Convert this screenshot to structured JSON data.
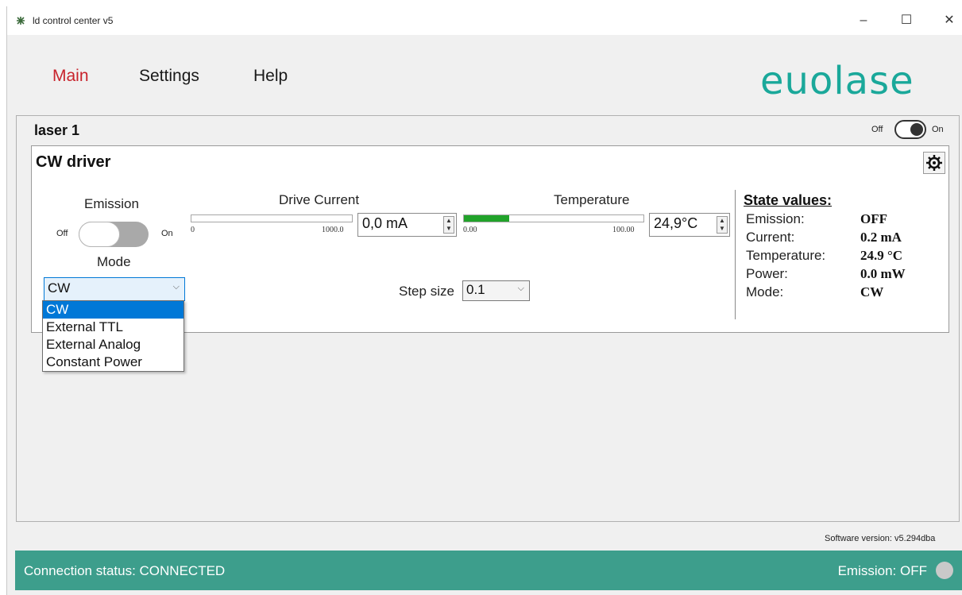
{
  "window": {
    "title": "ld control center v5",
    "minimize": "–",
    "maximize": "☐",
    "close": "✕"
  },
  "menu": {
    "items": [
      {
        "label": "Main",
        "active": true
      },
      {
        "label": "Settings",
        "active": false
      },
      {
        "label": "Help",
        "active": false
      }
    ],
    "logo_text": "euolase"
  },
  "laser": {
    "title": "laser 1",
    "toggle_off": "Off",
    "toggle_on": "On"
  },
  "cw_driver": {
    "title": "CW driver",
    "emission_label": "Emission",
    "emission_off": "Off",
    "emission_on": "On",
    "mode_label": "Mode",
    "mode_value": "CW",
    "drive_current": {
      "label": "Drive Current",
      "min": "0",
      "max": "1000.0",
      "value": "0,0 mA",
      "fill_fraction": 0.0
    },
    "temperature": {
      "label": "Temperature",
      "min": "0.00",
      "max": "100.00",
      "value": "24,9°C",
      "fill_fraction": 0.25
    },
    "step_size_label": "Step size",
    "step_size_value": "0.1"
  },
  "state_values": {
    "heading": "State values:",
    "rows": [
      {
        "label": "Emission:",
        "value": "OFF"
      },
      {
        "label": "Current:",
        "value": "0.2 mA"
      },
      {
        "label": "Temperature:",
        "value": "24.9 °C"
      },
      {
        "label": "Power:",
        "value": "0.0 mW"
      },
      {
        "label": "Mode:",
        "value": "CW"
      }
    ]
  },
  "mode_dropdown": {
    "options": [
      "CW",
      "External TTL",
      "External Analog",
      "Constant Power"
    ],
    "selected": "CW"
  },
  "footer": {
    "version": "Software version:  v5.294dba",
    "connection_status": "Connection status: CONNECTED",
    "emission_status": "Emission: OFF"
  },
  "colors": {
    "accent_red": "#c8232c",
    "brand_teal": "#1aa89a",
    "statusbar": "#3d9e8c",
    "selection_blue": "#0078d7",
    "temp_fill": "#21a32a"
  }
}
